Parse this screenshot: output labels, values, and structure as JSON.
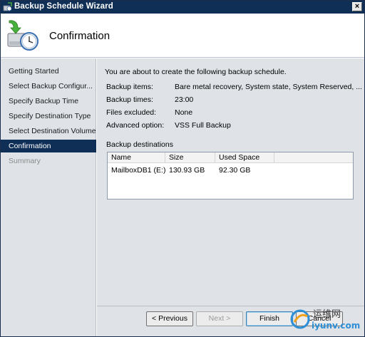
{
  "window": {
    "title": "Backup Schedule Wizard",
    "close_glyph": "×"
  },
  "header": {
    "heading": "Confirmation",
    "icon": "backup-schedule-clock-icon"
  },
  "sidebar": {
    "items": [
      {
        "label": "Getting Started",
        "state": "normal"
      },
      {
        "label": "Select Backup Configur...",
        "state": "normal"
      },
      {
        "label": "Specify Backup Time",
        "state": "normal"
      },
      {
        "label": "Specify Destination Type",
        "state": "normal"
      },
      {
        "label": "Select Destination Volume",
        "state": "normal"
      },
      {
        "label": "Confirmation",
        "state": "active"
      },
      {
        "label": "Summary",
        "state": "disabled"
      }
    ]
  },
  "content": {
    "intro": "You are about to create the following backup schedule.",
    "details": [
      {
        "label": "Backup items:",
        "value": "Bare metal recovery, System state, System Reserved, ..."
      },
      {
        "label": "Backup times:",
        "value": "23:00"
      },
      {
        "label": "Files excluded:",
        "value": "None"
      },
      {
        "label": "Advanced option:",
        "value": "VSS Full Backup"
      }
    ],
    "destinations_label": "Backup destinations",
    "table": {
      "columns": [
        "Name",
        "Size",
        "Used Space"
      ],
      "rows": [
        [
          "MailboxDB1 (E:)",
          "130.93 GB",
          "92.30 GB"
        ]
      ]
    }
  },
  "footer": {
    "previous": "< Previous",
    "next": "Next >",
    "finish": "Finish",
    "cancel": "Cancel"
  },
  "watermark": {
    "line1": "运维网",
    "line2": "iyunv.com"
  },
  "colors": {
    "titlebar": "#102f57",
    "selection": "#102f57",
    "panel": "#dfe3e8"
  }
}
